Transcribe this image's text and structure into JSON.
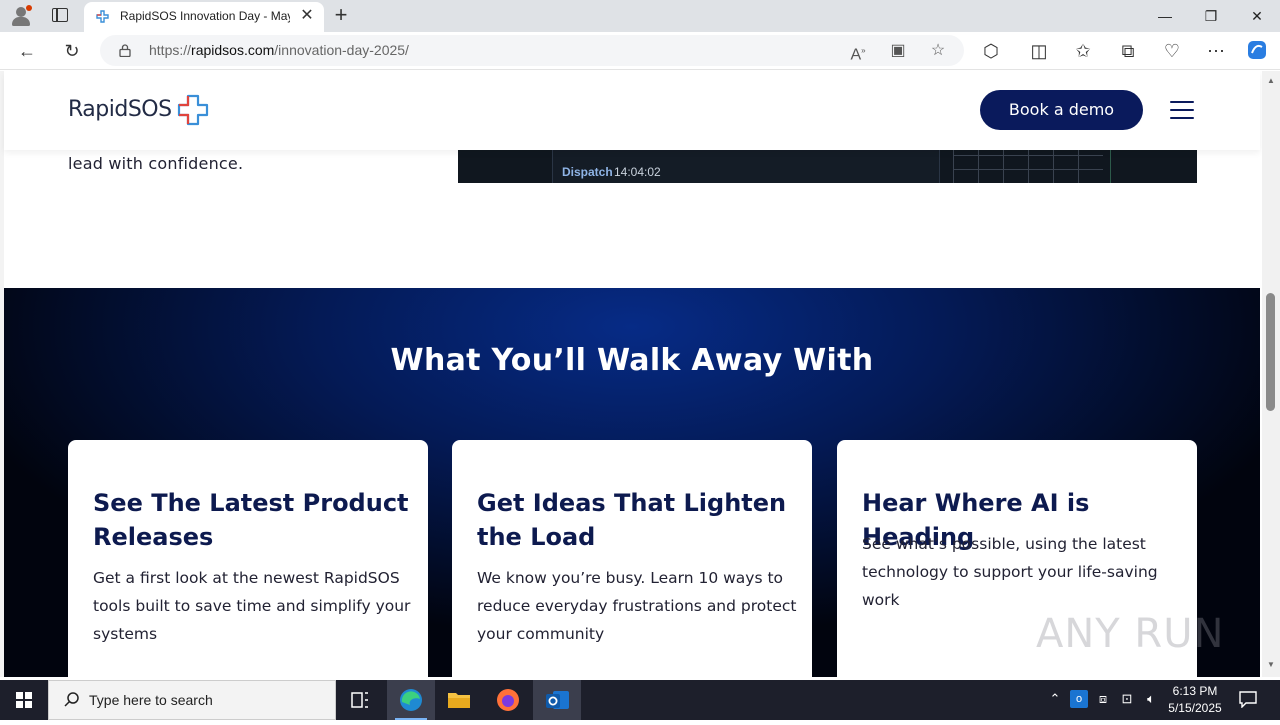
{
  "browser": {
    "tab_title": "RapidSOS Innovation Day - May",
    "url_prefix": "https://",
    "url_host": "rapidsos.com",
    "url_path": "/innovation-day-2025/"
  },
  "page": {
    "logo_text": "RapidSOS",
    "demo_button": "Book a demo",
    "hero_text": "lead with confidence.",
    "video_label": "Dispatch",
    "video_time": "14:04:02",
    "section_title": "What You’ll Walk Away With",
    "cards": [
      {
        "title": "See The Latest Product Releases",
        "body": "Get a first look at the newest RapidSOS tools built to save time and simplify your systems"
      },
      {
        "title": "Get Ideas That Lighten the Load",
        "body": "We know you’re busy. Learn 10 ways to reduce everyday frustrations and protect your community"
      },
      {
        "title": "Hear Where AI is Heading",
        "body": "See what’s possible, using the latest technology to support your life-saving work"
      }
    ],
    "watermark": "ANY RUN"
  },
  "taskbar": {
    "search_placeholder": "Type here to search",
    "time": "6:13 PM",
    "date": "5/15/2025"
  },
  "colors": {
    "brand_navy": "#0a1a5c",
    "section_blue": "#062b86",
    "logo_red": "#e0443d",
    "logo_blue": "#3a8fd8"
  }
}
